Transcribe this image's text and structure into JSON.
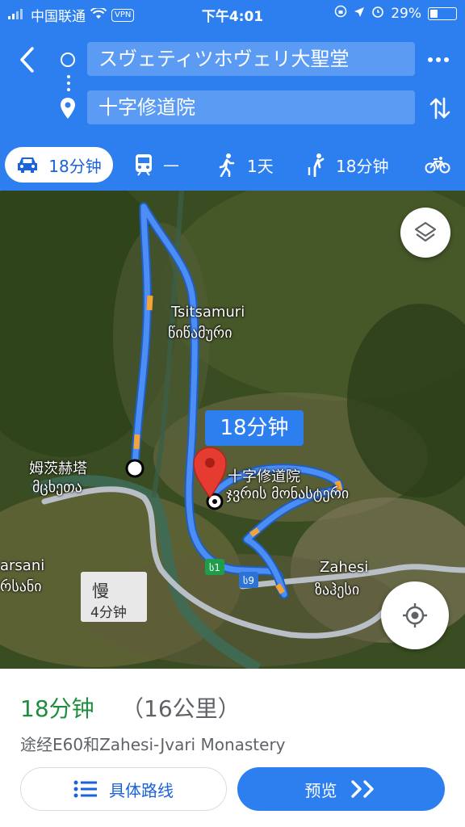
{
  "status_bar": {
    "carrier": "中国联通",
    "vpn": "VPN",
    "time": "下午4:01",
    "battery": "29%"
  },
  "header": {
    "origin": "スヴェティツホヴェリ大聖堂",
    "destination": "十字修道院",
    "bg_color": "#2d7ff0"
  },
  "modes": [
    {
      "icon": "car-icon",
      "label": "18分钟",
      "active": true
    },
    {
      "icon": "transit-icon",
      "label": "—"
    },
    {
      "icon": "walk-icon",
      "label": "1天"
    },
    {
      "icon": "ride-icon",
      "label": "18分钟"
    },
    {
      "icon": "bike-icon",
      "label": ""
    }
  ],
  "map": {
    "place_labels": {
      "tsitsamuri_latin": "Tsitsamuri",
      "tsitsamuri_georgian": "წიწამური",
      "mtskheta_cn": "姆茨赫塔",
      "mtskheta_georgian": "მცხეთა",
      "monastery_cn": "十字修道院",
      "monastery_georgian": "ჯვრის მონასტერი",
      "zahesi_latin": "Zahesi",
      "zahesi_georgian": "ზაჰესი",
      "tsarsani_latin": "arsani",
      "tsarsani_georgian": "რსანი"
    },
    "route_callout": "18分钟",
    "alt_route": {
      "label": "慢",
      "time": "4分钟"
    },
    "road_shields": [
      "ს1",
      "ს9"
    ]
  },
  "summary": {
    "duration": "18分钟",
    "distance": "（16公里）",
    "via": "途经E60和Zahesi-Jvari Monastery",
    "steps_button": "具体路线",
    "preview_button": "预览",
    "duration_color": "#1e8e3e"
  }
}
